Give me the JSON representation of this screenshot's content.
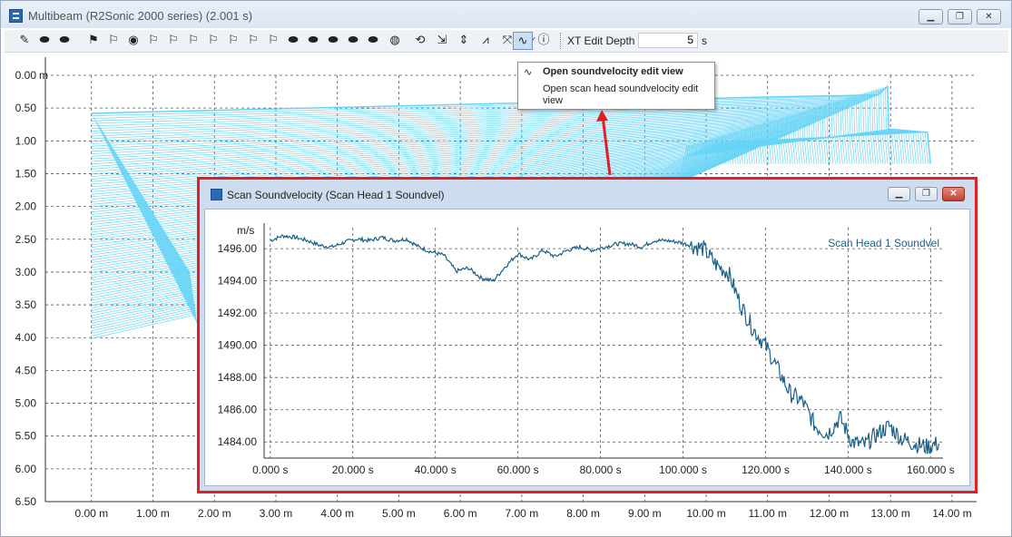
{
  "window": {
    "title": "Multibeam (R2Sonic 2000 series) (2.001 s)",
    "buttons": [
      "▁",
      "❐",
      "✕"
    ]
  },
  "toolbar": {
    "icons": [
      "pencil-icon",
      "eraser-icon",
      "eraser-brush-icon",
      "flag-filled-icon",
      "flag-outline-icon",
      "flag-circle-icon",
      "flag-undo-icon",
      "flag-1-icon",
      "flag-2-icon",
      "flag-3-icon",
      "flag-4-icon",
      "flag-5-icon",
      "flag-6-icon",
      "eraser-2-icon",
      "eraser-3-icon",
      "eraser-4-icon",
      "eraser-5-icon",
      "eraser-6-icon",
      "globe-icon",
      "arrows-icon",
      "pan-icon",
      "move-icon",
      "sonar-icon",
      "scatter-icon",
      "waveform-icon",
      "soundvelocity-icon",
      "info-icon"
    ],
    "depth_label": "XT Edit Depth",
    "depth_value": "5",
    "depth_unit": "s"
  },
  "tooltip": {
    "title": "Open soundvelocity edit view",
    "description": "Open scan head soundvelocity edit view"
  },
  "sub_window": {
    "title": "Scan Soundvelocity (Scan Head 1 Soundvel)"
  },
  "chart_data": [
    {
      "type": "line",
      "title": "",
      "xlabel": "",
      "ylabel": "m",
      "x_ticks": [
        "0.00 m",
        "1.00 m",
        "2.00 m",
        "3.00 m",
        "4.00 m",
        "5.00 m",
        "6.00 m",
        "7.00 m",
        "8.00 m",
        "9.00 m",
        "10.00 m",
        "11.00 m",
        "12.00 m",
        "13.00 m",
        "14.00 m"
      ],
      "y_ticks": [
        "0.00",
        "0.50",
        "1.00",
        "1.50",
        "2.00",
        "2.50",
        "3.00",
        "3.50",
        "4.00",
        "4.50",
        "5.00",
        "5.50",
        "6.00",
        "6.50"
      ],
      "xlim": [
        -0.75,
        14.4
      ],
      "ylim": [
        6.5,
        0.0
      ],
      "y_inverted": true,
      "grid": true,
      "color": "#66d4f6",
      "series": [
        {
          "description": "multibeam swath fan from sensor",
          "origin": [
            0.0,
            0.58
          ],
          "near_edge": [
            [
              0.0,
              0.58
            ],
            [
              1.6,
              3.0
            ],
            [
              1.76,
              4.05
            ]
          ],
          "far_edge": [
            [
              0.0,
              0.58
            ],
            [
              4.0,
              0.49
            ],
            [
              8.0,
              0.4
            ],
            [
              11.0,
              0.33
            ],
            [
              12.8,
              0.3
            ],
            [
              12.95,
              0.17
            ],
            [
              12.97,
              0.82
            ],
            [
              13.6,
              0.87
            ],
            [
              13.65,
              1.35
            ]
          ]
        }
      ]
    },
    {
      "type": "line",
      "title": "",
      "xlabel": "",
      "ylabel": "m/s",
      "x_ticks": [
        "0.000 s",
        "20.000 s",
        "40.000 s",
        "60.000 s",
        "80.000 s",
        "100.000 s",
        "120.000 s",
        "140.000 s",
        "160.000 s"
      ],
      "y_ticks": [
        "1484.00",
        "1486.00",
        "1488.00",
        "1490.00",
        "1492.00",
        "1494.00",
        "1496.00"
      ],
      "xlim": [
        -1.5,
        163
      ],
      "ylim": [
        1483.0,
        1497.3
      ],
      "grid": true,
      "legend": "top-right",
      "series": [
        {
          "name": "Scan Head 1 Soundvel",
          "color": "#1a5f86",
          "x": [
            0,
            3,
            6,
            9,
            12,
            15,
            18,
            21,
            24,
            27,
            30,
            33,
            36,
            39,
            42,
            45,
            48,
            51,
            54,
            57,
            60,
            63,
            66,
            69,
            72,
            75,
            78,
            81,
            84,
            87,
            90,
            93,
            96,
            99,
            102,
            105,
            108,
            111,
            114,
            117,
            120,
            123,
            126,
            129,
            132,
            135,
            138,
            141,
            144,
            147,
            150,
            153,
            156,
            159,
            162
          ],
          "y": [
            1496.5,
            1496.8,
            1496.7,
            1496.5,
            1496.2,
            1496.1,
            1496.4,
            1496.6,
            1496.5,
            1496.7,
            1496.5,
            1496.6,
            1496.1,
            1495.8,
            1495.6,
            1494.6,
            1494.8,
            1494.2,
            1494.0,
            1494.9,
            1495.7,
            1495.3,
            1495.9,
            1495.5,
            1495.9,
            1496.1,
            1495.9,
            1496.1,
            1496.3,
            1496.3,
            1496.1,
            1496.5,
            1496.5,
            1496.4,
            1496.2,
            1496.0,
            1495.0,
            1494.5,
            1492.5,
            1491.0,
            1490.0,
            1488.5,
            1487.0,
            1486.5,
            1485.0,
            1484.5,
            1485.5,
            1484.0,
            1483.8,
            1484.5,
            1485.0,
            1484.2,
            1483.9,
            1483.7,
            1483.9
          ]
        }
      ]
    }
  ]
}
